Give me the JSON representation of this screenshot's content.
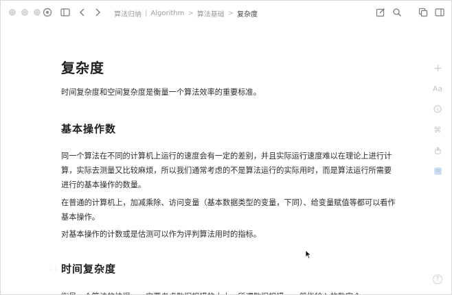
{
  "breadcrumb": {
    "items": [
      "算法归纳",
      "Algorithm",
      "算法基础"
    ],
    "separators": [
      "|",
      ">",
      ">"
    ],
    "current": "复杂度"
  },
  "article": {
    "title": "复杂度",
    "intro": "时间复杂度和空间复杂度是衡量一个算法效率的重要标准。",
    "section1_heading": "基本操作数",
    "para1": "同一个算法在不同的计算机上运行的速度会有一定的差别，并且实际运行速度难以在理论上进行计算，实际去测量又比较麻烦，所以我们通常考虑的不是算法运行的实际用时，而是算法运行所需要进行的基本操作的数量。",
    "para2": "在普通的计算机上，加减乘除、访问变量（基本数据类型的变量，下同）、给变量赋值等都可以看作基本操作。",
    "para3": "对基本操作的计数或是估测可以作为评判算法用时的指标。",
    "section2_heading": "时间复杂度",
    "para4_partial": "衡量一个算法的快慢，一定要考虑数据规模的大小。所谓数据规模，一般指输入的数字个"
  },
  "right_rail": {
    "icons": [
      "plus-icon",
      "font-size-icon",
      "info-icon",
      "command-icon",
      "share-icon",
      "panel-icon"
    ],
    "font_label": "Aa",
    "command_glyph": "⌘",
    "help_glyph": "?"
  }
}
